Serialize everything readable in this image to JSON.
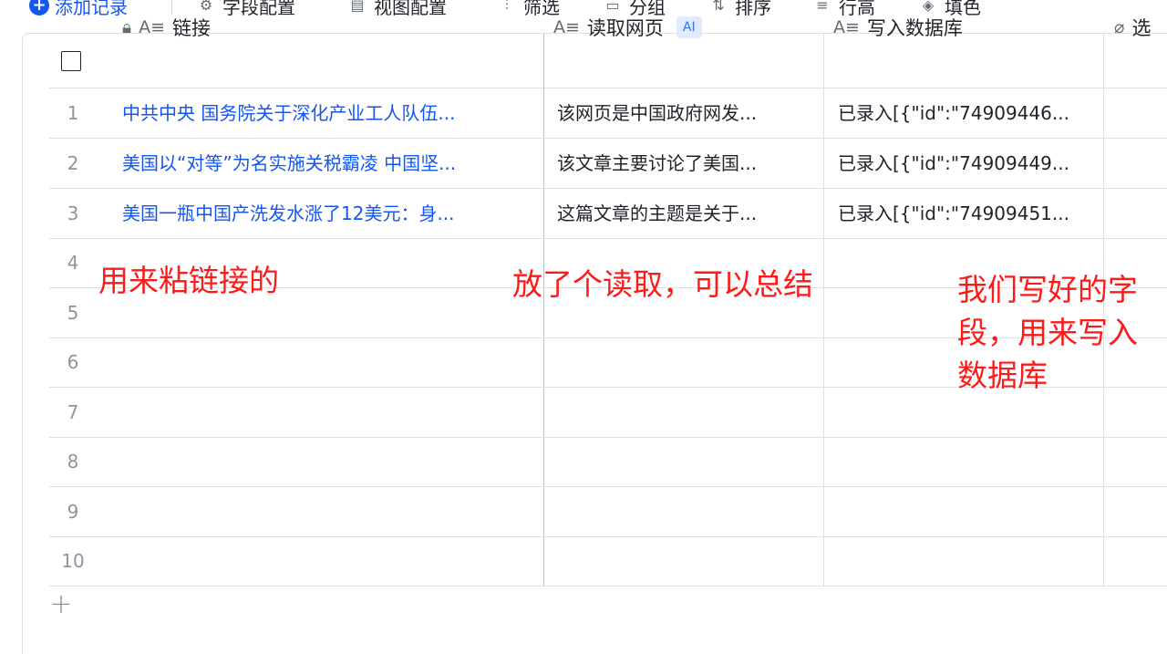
{
  "toolbar": {
    "add_record": "添加记录",
    "field_config": "字段配置",
    "view_config": "视图配置",
    "filter": "筛选",
    "group": "分组",
    "sort": "排序",
    "row_height": "行高",
    "fill_color": "填色"
  },
  "columns": {
    "link": "链接",
    "read_web": "读取网页",
    "ai_badge": "AI",
    "write_db": "写入数据库",
    "attach": "选"
  },
  "rows": [
    {
      "num": "1",
      "link": "中共中央 国务院关于深化产业工人队伍...",
      "read": "该网页是中国政府网发...",
      "write": "已录入[{\"id\":\"74909446..."
    },
    {
      "num": "2",
      "link": "美国以“对等”为名实施关税霸凌 中国坚...",
      "read": "该文章主要讨论了美国...",
      "write": "已录入[{\"id\":\"74909449..."
    },
    {
      "num": "3",
      "link": "美国一瓶中国产洗发水涨了12美元：身...",
      "read": "这篇文章的主题是关于...",
      "write": "已录入[{\"id\":\"74909451..."
    },
    {
      "num": "4"
    },
    {
      "num": "5"
    },
    {
      "num": "6"
    },
    {
      "num": "7"
    },
    {
      "num": "8"
    },
    {
      "num": "9"
    },
    {
      "num": "10"
    }
  ],
  "annotations": {
    "a1": "用来粘链接的",
    "a2": "放了个读取，可以总结",
    "a3_line1": "我们写好的字",
    "a3_line2": "段，用来写入",
    "a3_line3": "数据库"
  },
  "colors": {
    "accent": "#1456f0",
    "annotation": "#ff1a1a"
  }
}
